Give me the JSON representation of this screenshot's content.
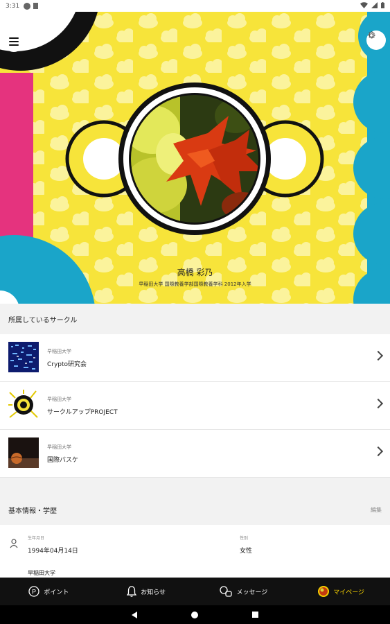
{
  "status_bar": {
    "time": "3:31"
  },
  "profile": {
    "name": "高橋 彩乃",
    "affiliation": "早稲田大学 国際教養学部国際教養学科 2012年入学"
  },
  "circles_section": {
    "title": "所属しているサークル",
    "items": [
      {
        "university": "早稲田大学",
        "name": "Crypto研究会"
      },
      {
        "university": "早稲田大学",
        "name": "サークルアップPROJECT"
      },
      {
        "university": "早稲田大学",
        "name": "国際バスケ"
      }
    ]
  },
  "basic_section": {
    "title": "基本情報・学歴",
    "edit_label": "編集",
    "birthday_label": "生年月日",
    "birthday_value": "1994年04月14日",
    "gender_label": "性別",
    "gender_value": "女性",
    "school_value": "早稲田大学"
  },
  "tabs": [
    {
      "label": "ポイント",
      "icon": "point-icon"
    },
    {
      "label": "お知らせ",
      "icon": "bell-icon"
    },
    {
      "label": "メッセージ",
      "icon": "message-icon"
    },
    {
      "label": "マイページ",
      "icon": "avatar-icon"
    }
  ],
  "colors": {
    "hero_yellow": "#f7e43a",
    "accent_blue": "#1aa5c9",
    "accent_pink": "#e5337e",
    "active_tab": "#f5d000"
  }
}
